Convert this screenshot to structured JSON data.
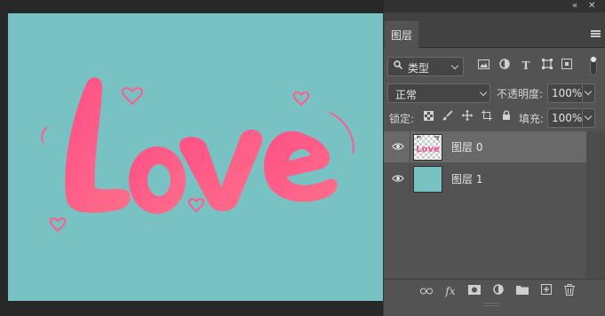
{
  "canvas": {
    "background": "#79c2c3",
    "artwork_text": "Love",
    "text_color": "#ff5c8d"
  },
  "panel": {
    "collapse_glyph": "«",
    "close_glyph": "✕",
    "tab_label": "图层",
    "filter": {
      "search_glyph": "🔍",
      "kind_label": "类型",
      "icons": [
        "image-filter-icon",
        "adjustment-filter-icon",
        "type-filter-icon",
        "shape-filter-icon",
        "smart-object-filter-icon"
      ]
    },
    "blend_mode": "正常",
    "opacity_label": "不透明度:",
    "opacity_value": "100%",
    "lock_label": "锁定:",
    "fill_label": "填充:",
    "fill_value": "100%",
    "layers": [
      {
        "name": "图层 0",
        "selected": true,
        "thumb": "love-thumb"
      },
      {
        "name": "图层 1",
        "selected": false,
        "thumb": "teal-fill",
        "color": "#79c2c3"
      }
    ],
    "bottom_icons": [
      "link-icon",
      "fx-icon",
      "mask-icon",
      "adjustment-icon",
      "folder-icon",
      "new-layer-icon",
      "trash-icon"
    ],
    "fx_label": "fx"
  }
}
